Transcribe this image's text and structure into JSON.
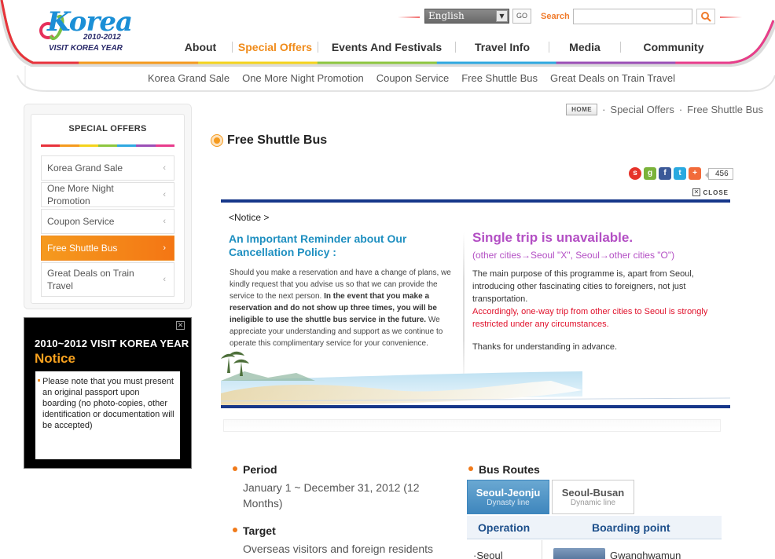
{
  "header": {
    "logo": {
      "word": "Korea",
      "years": "2010-2012",
      "tagline": "VISIT KOREA YEAR"
    },
    "language": {
      "selected": "English",
      "go_label": "GO"
    },
    "search": {
      "label": "Search",
      "placeholder": ""
    },
    "gnb": [
      {
        "label": "About",
        "active": false
      },
      {
        "label": "Special Offers",
        "active": true
      },
      {
        "label": "Events And Festivals",
        "active": false
      },
      {
        "label": "Travel Info",
        "active": false
      },
      {
        "label": "Media",
        "active": false
      },
      {
        "label": "Community",
        "active": false
      }
    ],
    "subnav": [
      "Korea Grand Sale",
      "One More Night Promotion",
      "Coupon Service",
      "Free Shuttle Bus",
      "Great Deals on Train Travel"
    ],
    "rainbow_colors": [
      "#e8323c",
      "#f59a1e",
      "#f4d31c",
      "#8dc63f",
      "#2fa8e0",
      "#9b4fb6",
      "#e83c8c"
    ]
  },
  "sidebar": {
    "title": "SPECIAL OFFERS",
    "items": [
      {
        "label": "Korea Grand Sale",
        "active": false
      },
      {
        "label": "One More Night Promotion",
        "active": false
      },
      {
        "label": "Coupon Service",
        "active": false
      },
      {
        "label": "Free Shuttle Bus",
        "active": true
      },
      {
        "label": "Great Deals on Train Travel",
        "active": false
      }
    ]
  },
  "notice_popup": {
    "title": "2010~2012  VISIT KOREA YEAR",
    "subtitle": "Notice",
    "body": "Please note that you must present an original passport upon boarding (no photo-copies, other identification or documentation will be accepted)"
  },
  "breadcrumb": {
    "home": "HOME",
    "items": [
      "Special Offers",
      "Free Shuttle Bus"
    ]
  },
  "page_title": "Free Shuttle Bus",
  "share": {
    "count": "456"
  },
  "board": {
    "close_label": "CLOSE",
    "tag": "<Notice >",
    "left_heading": "An Important Reminder about Our Cancellation Policy :",
    "left_text_1": "Should you make a reservation and have a change of plans, we kindly request that you advise us so that we can provide the service to the next person.",
    "left_text_bold": "In the event that you make a reservation and do not show up three times, you will be ineligible to use the shuttle bus service in the future.",
    "left_text_2": "We appreciate your understanding and support as we continue to operate this complimentary service for your convenience.",
    "right_heading": "Single trip is unavailable.",
    "right_sub": "(other cities→Seoul \"X\", Seoul→other cities \"O\")",
    "right_body": "The main purpose of this programme is, apart from Seoul, introducing other fascinating cities to foreigners, not just transportation.",
    "right_red": "Accordingly, one-way trip from other cities to Seoul is strongly restricted under any circumstances.",
    "right_thanks": "Thanks for understanding in advance."
  },
  "info": {
    "period": {
      "label": "Period",
      "text": "January 1 ~ December 31, 2012 (12 Months)"
    },
    "target": {
      "label": "Target",
      "text": "Overseas visitors and foreign residents"
    },
    "routes": {
      "label": "Bus Routes",
      "tabs": [
        {
          "title": "Seoul-Jeonju",
          "subtitle": "Dynasty line",
          "active": true
        },
        {
          "title": "Seoul-Busan",
          "subtitle": "Dynamic line",
          "active": false
        }
      ],
      "col_operation": "Operation",
      "col_boarding": "Boarding point",
      "row_operation": "·Seoul",
      "row_boarding": "Gwanghwamun"
    }
  }
}
